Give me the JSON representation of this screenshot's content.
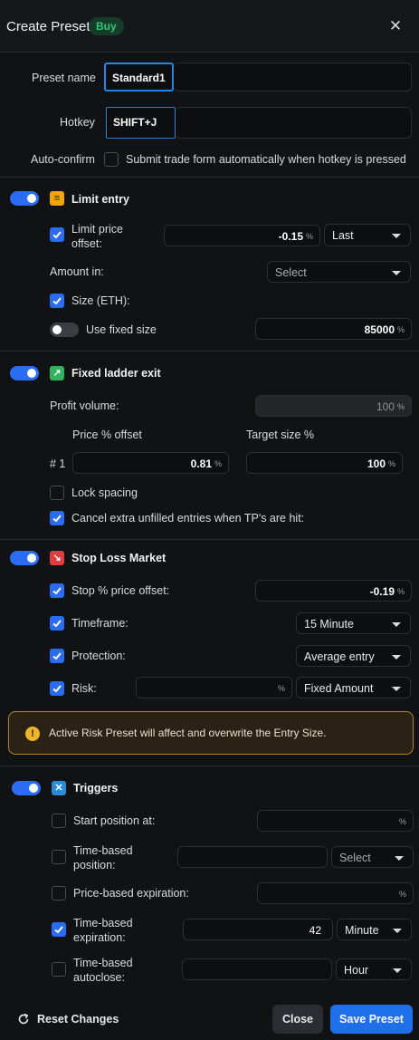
{
  "header": {
    "title": "Create Preset",
    "badge": "Buy",
    "close_icon": "close-icon"
  },
  "general": {
    "preset_name_label": "Preset name",
    "preset_name_value": "Standard1",
    "hotkey_label": "Hotkey",
    "hotkey_value": "SHIFT+J",
    "autoconfirm_label": "Auto-confirm",
    "autoconfirm_checked": false,
    "autoconfirm_desc": "Submit trade form automatically when hotkey is pressed"
  },
  "limit_entry": {
    "enabled": true,
    "title": "Limit entry",
    "icon": "limit-entry-icon",
    "limit_price_offset_label_1": "Limit price",
    "limit_price_offset_label_2": "offset:",
    "limit_price_offset_checked": true,
    "limit_price_offset_value": "-0.15",
    "limit_price_offset_unit": "%",
    "limit_price_ref": "Last",
    "amount_in_label": "Amount in:",
    "amount_in_placeholder": "Select",
    "size_label": "Size (ETH):",
    "size_checked": true,
    "use_fixed_size_label": "Use fixed size",
    "use_fixed_size_on": false,
    "fixed_size_value": "85000",
    "fixed_size_unit": "%"
  },
  "ladder_exit": {
    "enabled": true,
    "title": "Fixed ladder exit",
    "icon": "arrow-up-right-icon",
    "profit_volume_label": "Profit volume:",
    "profit_volume_value": "100",
    "profit_volume_unit": "%",
    "price_offset_header": "Price % offset",
    "target_size_header": "Target size %",
    "rows": [
      {
        "index": "# 1",
        "price_offset": "0.81",
        "target_size": "100",
        "unit": "%"
      }
    ],
    "lock_spacing_label": "Lock spacing",
    "lock_spacing_checked": false,
    "cancel_extra_label": "Cancel extra unfilled entries when TP's are hit:",
    "cancel_extra_checked": true
  },
  "stop_loss": {
    "enabled": true,
    "title": "Stop Loss Market",
    "icon": "arrow-down-right-icon",
    "stop_offset_label": "Stop % price offset:",
    "stop_offset_checked": true,
    "stop_offset_value": "-0.19",
    "stop_offset_unit": "%",
    "timeframe_label": "Timeframe:",
    "timeframe_checked": true,
    "timeframe_value": "15 Minute",
    "protection_label": "Protection:",
    "protection_checked": true,
    "protection_value": "Average entry",
    "risk_label": "Risk:",
    "risk_checked": true,
    "risk_unit": "%",
    "risk_mode": "Fixed Amount"
  },
  "warning": {
    "text": "Active Risk Preset will affect and overwrite the Entry Size.",
    "icon": "exclamation-icon"
  },
  "triggers": {
    "enabled": true,
    "title": "Triggers",
    "icon": "triggers-icon",
    "start_position_label": "Start position at:",
    "start_position_checked": false,
    "start_position_unit": "%",
    "time_position_label_1": "Time-based",
    "time_position_label_2": "position:",
    "time_position_checked": false,
    "time_position_unit_placeholder": "Select",
    "price_expiration_label": "Price-based expiration:",
    "price_expiration_checked": false,
    "price_expiration_unit": "%",
    "time_expiration_label_1": "Time-based",
    "time_expiration_label_2": "expiration:",
    "time_expiration_checked": true,
    "time_expiration_value": "42",
    "time_expiration_unit": "Minute",
    "time_autoclose_label_1": "Time-based",
    "time_autoclose_label_2": "autoclose:",
    "time_autoclose_checked": false,
    "time_autoclose_unit": "Hour"
  },
  "footer": {
    "reset_label": "Reset Changes",
    "reset_icon": "reset-icon",
    "close_label": "Close",
    "save_label": "Save Preset"
  },
  "colors": {
    "accent": "#2a6df4",
    "buy_green": "#2fc777",
    "warning": "#f0b429",
    "background": "#111214"
  }
}
